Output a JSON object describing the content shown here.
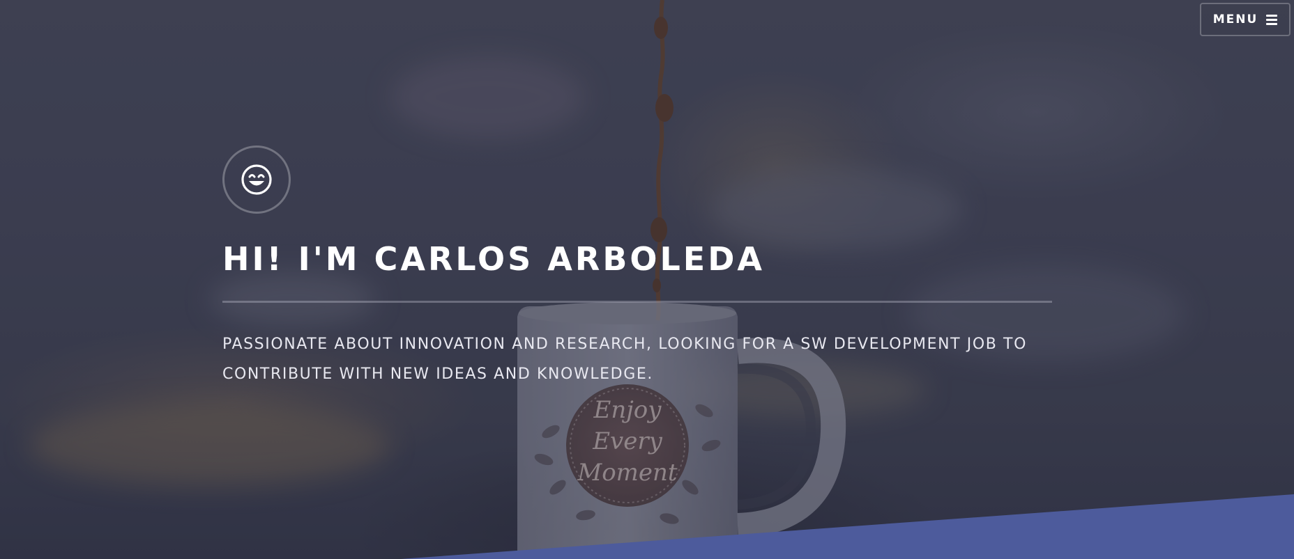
{
  "header": {
    "menu_label": "MENU",
    "menu_icon": "hamburger-icon"
  },
  "hero": {
    "avatar_icon": "smiling-face-icon",
    "headline": "HI! I'M CARLOS ARBOLEDA",
    "tagline": "PASSIONATE ABOUT INNOVATION AND RESEARCH, LOOKING FOR A SW DEVELOPMENT JOB TO CONTRIBUTE WITH NEW IDEAS AND KNOWLEDGE.",
    "background_image": {
      "mug_text": [
        "Enjoy",
        "Every",
        "Moment"
      ]
    }
  },
  "colors": {
    "accent": "#4d5b9c",
    "text": "#ffffff",
    "overlay": "#2d2f42"
  }
}
